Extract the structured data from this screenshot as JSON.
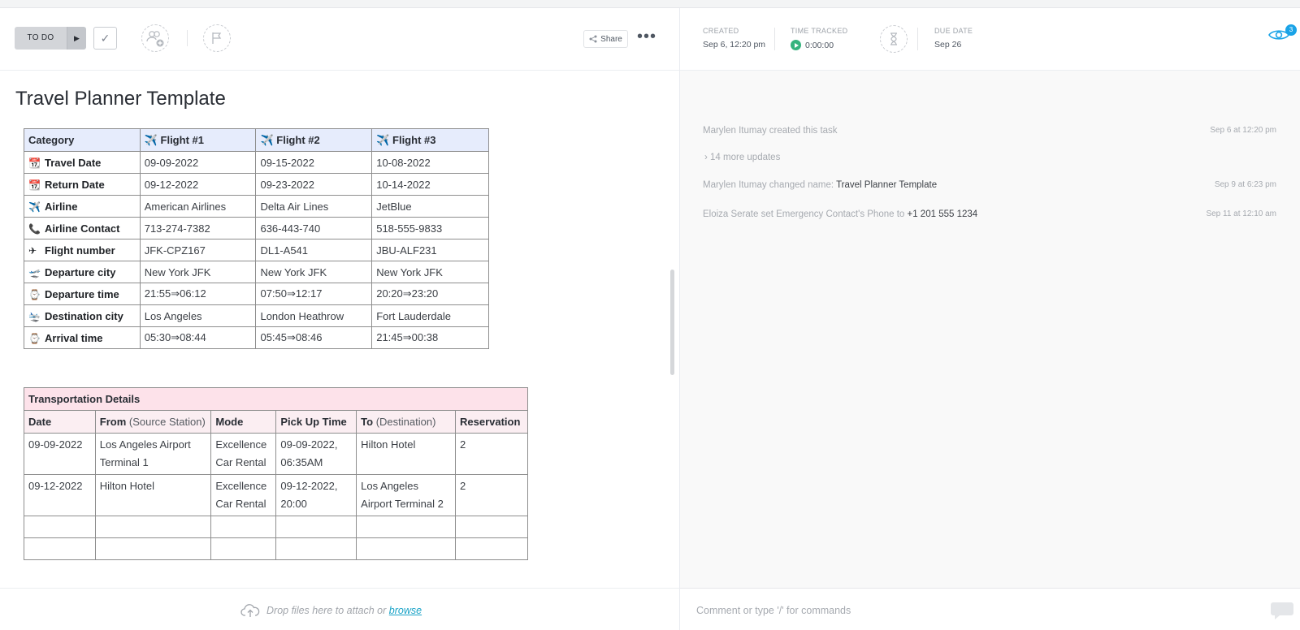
{
  "header": {
    "status_label": "TO DO",
    "status_arrow": "▶",
    "check": "✓",
    "share_label": "Share",
    "more_label": "•••"
  },
  "doc": {
    "title": "Travel Planner Template",
    "flights": {
      "headers": [
        "Category",
        "✈️ Flight #1",
        "✈️ Flight #2",
        "✈️ Flight #3"
      ],
      "rows": [
        {
          "icon": "📆",
          "label": "Travel Date",
          "values": [
            "09-09-2022",
            "09-15-2022",
            "10-08-2022"
          ]
        },
        {
          "icon": "📆",
          "label": "Return Date",
          "values": [
            "09-12-2022",
            "09-23-2022",
            "10-14-2022"
          ]
        },
        {
          "icon": "✈️",
          "label": "Airline",
          "values": [
            "American Airlines",
            "Delta Air Lines",
            "JetBlue"
          ]
        },
        {
          "icon": "📞",
          "label": "Airline Contact",
          "values": [
            "713-274-7382",
            "636-443-740",
            "518-555-9833"
          ]
        },
        {
          "icon": "✈",
          "label": "Flight number",
          "values": [
            "JFK-CPZ167",
            "DL1-A541",
            "JBU-ALF231"
          ]
        },
        {
          "icon": "🛫",
          "label": "Departure city",
          "values": [
            "New York JFK",
            "New York JFK",
            "New York JFK"
          ]
        },
        {
          "icon": "⌚",
          "label": "Departure time",
          "values": [
            "21:55⇒06:12",
            "07:50⇒12:17",
            "20:20⇒23:20"
          ]
        },
        {
          "icon": "🛬",
          "label": "Destination city",
          "values": [
            "Los Angeles",
            "London Heathrow",
            "Fort Lauderdale"
          ]
        },
        {
          "icon": "⌚",
          "label": "Arrival time",
          "values": [
            "05:30⇒08:44",
            "05:45⇒08:46",
            "21:45⇒00:38"
          ]
        }
      ]
    },
    "transport": {
      "caption": "Transportation Details",
      "headers": [
        {
          "main": "Date",
          "sub": ""
        },
        {
          "main": "From",
          "sub": " (Source Station)"
        },
        {
          "main": "Mode",
          "sub": ""
        },
        {
          "main": "Pick Up Time",
          "sub": ""
        },
        {
          "main": "To",
          "sub": " (Destination)"
        },
        {
          "main": "Reservation",
          "sub": ""
        }
      ],
      "rows": [
        [
          "09-09-2022",
          "Los Angeles Airport Terminal 1",
          "Excellence Car Rental",
          "09-09-2022, 06:35AM",
          "Hilton Hotel",
          "2"
        ],
        [
          "09-12-2022",
          "Hilton Hotel",
          "Excellence Car Rental",
          "09-12-2022, 20:00",
          "Los Angeles Airport Terminal 2",
          "2"
        ]
      ],
      "empty_rows": 2
    }
  },
  "footer_left": {
    "drop_text": "Drop files here to attach or ",
    "browse_link": "browse"
  },
  "meta": {
    "created_label": "CREATED",
    "created_value": "Sep 6, 12:20 pm",
    "time_label": "TIME TRACKED",
    "time_value": "0:00:00",
    "due_label": "DUE DATE",
    "due_value": "Sep 26",
    "watchers_count": "3"
  },
  "activity": [
    {
      "text": "Marylen Itumay created this task",
      "strong": "",
      "time": "Sep 6 at 12:20 pm"
    },
    {
      "text": "Marylen Itumay changed name: ",
      "strong": "Travel Planner Template",
      "time": "Sep 9 at 6:23 pm"
    },
    {
      "text": "Eloiza Serate set Emergency Contact's Phone to ",
      "strong": "+1 201 555 1234",
      "time": "Sep 11 at 12:10 am"
    }
  ],
  "more_updates": "›  14 more updates",
  "comment_placeholder": "Comment or type '/' for commands",
  "colors": {
    "accent": "#1aa3e7",
    "timer": "#36b37e",
    "flight_header": "#e6ecfc",
    "transport_header": "#fde2ea"
  }
}
